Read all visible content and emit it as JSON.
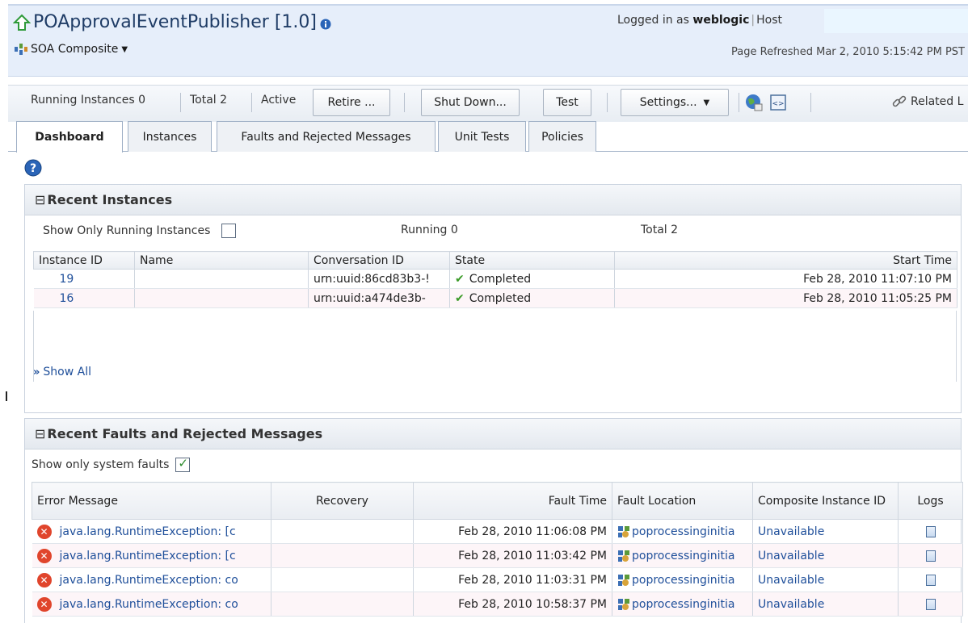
{
  "header": {
    "title": "POApprovalEventPublisher [1.0]",
    "subtype": "SOA Composite",
    "logged_in_prefix": "Logged in as",
    "user": "weblogic",
    "host_label": "Host",
    "refreshed": "Page Refreshed Mar 2, 2010 5:15:42 PM PST"
  },
  "toolbar": {
    "running_label": "Running Instances",
    "running_value": "0",
    "total_label": "Total",
    "total_value": "2",
    "active_label": "Active",
    "retire": "Retire ...",
    "shutdown": "Shut Down...",
    "test": "Test",
    "settings": "Settings...",
    "related": "Related L"
  },
  "tabs": [
    "Dashboard",
    "Instances",
    "Faults and Rejected Messages",
    "Unit Tests",
    "Policies"
  ],
  "recent_instances": {
    "title": "Recent Instances",
    "show_running_label": "Show Only Running Instances",
    "running_label": "Running",
    "running_value": "0",
    "total_label": "Total",
    "total_value": "2",
    "columns": [
      "Instance ID",
      "Name",
      "Conversation ID",
      "State",
      "Start Time"
    ],
    "rows": [
      {
        "id": "19",
        "name": "",
        "conversation": "urn:uuid:86cd83b3-!",
        "state": "Completed",
        "start": "Feb 28, 2010 11:07:10 PM"
      },
      {
        "id": "16",
        "name": "",
        "conversation": "urn:uuid:a474de3b-",
        "state": "Completed",
        "start": "Feb 28, 2010 11:05:25 PM"
      }
    ],
    "show_all": "Show All"
  },
  "recent_faults": {
    "title": "Recent Faults and Rejected Messages",
    "system_faults_label": "Show only system faults",
    "columns": [
      "Error Message",
      "Recovery",
      "Fault Time",
      "Fault Location",
      "Composite Instance ID",
      "Logs"
    ],
    "rows": [
      {
        "error": "java.lang.RuntimeException: [c",
        "recovery": "",
        "time": "Feb 28, 2010 11:06:08 PM",
        "location": "poprocessinginitia",
        "instance": "Unavailable"
      },
      {
        "error": "java.lang.RuntimeException: [c",
        "recovery": "",
        "time": "Feb 28, 2010 11:03:42 PM",
        "location": "poprocessinginitia",
        "instance": "Unavailable"
      },
      {
        "error": "java.lang.RuntimeException: co",
        "recovery": "",
        "time": "Feb 28, 2010 11:03:31 PM",
        "location": "poprocessinginitia",
        "instance": "Unavailable"
      },
      {
        "error": "java.lang.RuntimeException: co",
        "recovery": "",
        "time": "Feb 28, 2010 10:58:37 PM",
        "location": "poprocessinginitia",
        "instance": "Unavailable"
      }
    ]
  },
  "colors": {
    "header_bg": "#e6eefa",
    "link": "#1f4f9a",
    "error": "#e0452c",
    "success": "#3a9a27"
  }
}
